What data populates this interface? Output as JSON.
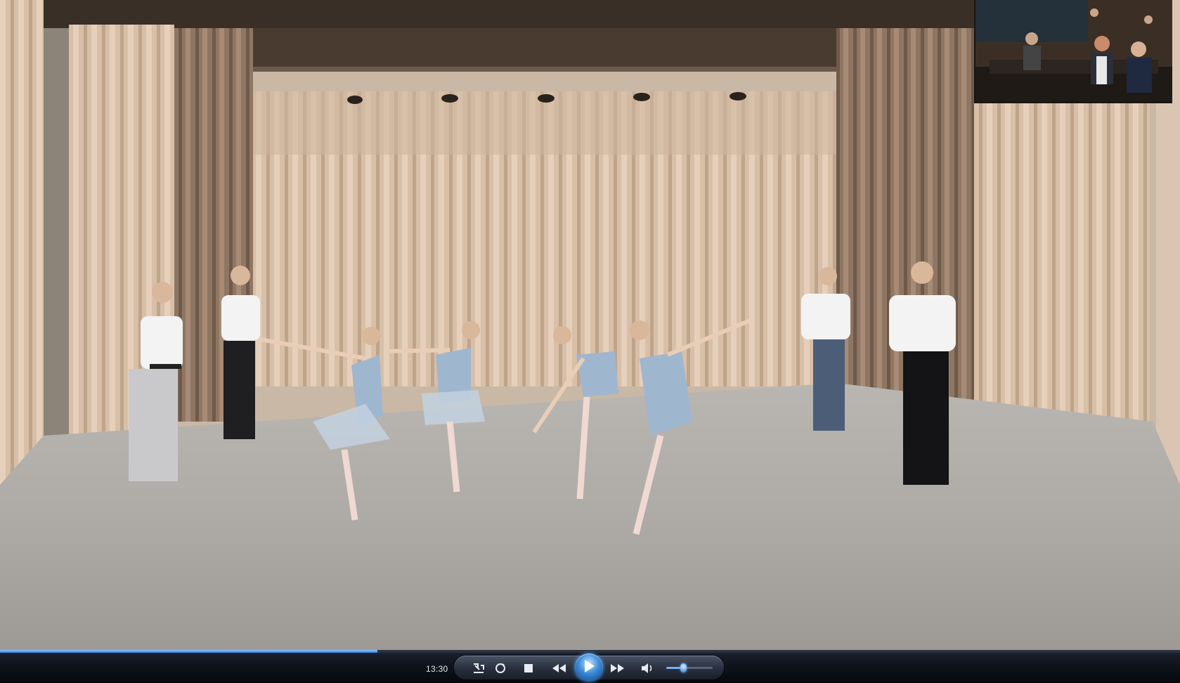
{
  "player": {
    "elapsed_time": "13:30",
    "progress_fraction": 0.32,
    "volume_fraction": 0.36,
    "state": "paused",
    "accent_color": "#2b7fe0"
  },
  "controls": [
    {
      "name": "switch-view-icon"
    },
    {
      "name": "repeat-icon"
    },
    {
      "name": "stop-icon"
    },
    {
      "name": "previous-icon"
    },
    {
      "name": "play-icon"
    },
    {
      "name": "next-icon"
    },
    {
      "name": "volume-icon"
    }
  ]
}
